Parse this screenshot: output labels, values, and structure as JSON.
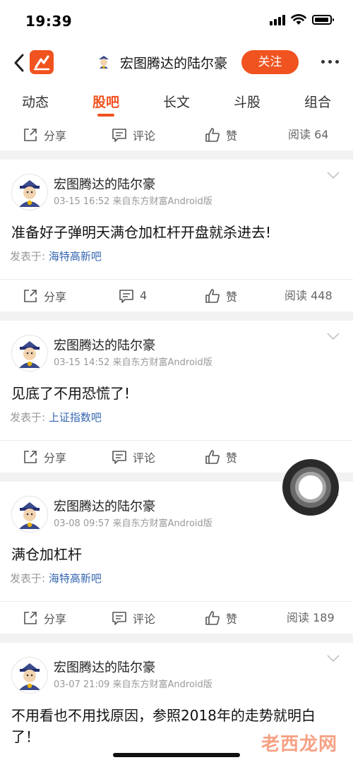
{
  "status": {
    "time": "19:39"
  },
  "header": {
    "title": "宏图腾达的陆尔豪",
    "follow_label": "关注"
  },
  "tabs": [
    {
      "label": "动态"
    },
    {
      "label": "股吧"
    },
    {
      "label": "长文"
    },
    {
      "label": "斗股"
    },
    {
      "label": "组合"
    }
  ],
  "active_tab": "股吧",
  "top_actions": {
    "share": "分享",
    "comment": "评论",
    "like": "赞",
    "read": "阅读 64"
  },
  "posts": [
    {
      "author": "宏图腾达的陆尔豪",
      "meta": "03-15 16:52 来自东方财富Android版",
      "text": "准备好子弹明天满仓加杠杆开盘就杀进去!",
      "origin_prefix": "发表于:",
      "board": "海特高新吧",
      "share": "分享",
      "comment": "4",
      "like": "赞",
      "read": "阅读 448"
    },
    {
      "author": "宏图腾达的陆尔豪",
      "meta": "03-15 14:52 来自东方财富Android版",
      "text": "见底了不用恐慌了!",
      "origin_prefix": "发表于:",
      "board": "上证指数吧",
      "share": "分享",
      "comment": "评论",
      "like": "赞",
      "read": ""
    },
    {
      "author": "宏图腾达的陆尔豪",
      "meta": "03-08 09:57 来自东方财富Android版",
      "text": "满仓加杠杆",
      "origin_prefix": "发表于:",
      "board": "海特高新吧",
      "share": "分享",
      "comment": "评论",
      "like": "赞",
      "read": "阅读 189"
    },
    {
      "author": "宏图腾达的陆尔豪",
      "meta": "03-07 21:09 来自东方财富Android版",
      "text": "不用看也不用找原因，参照2018年的走势就明白了！"
    }
  ],
  "watermark": "老西龙网",
  "colors": {
    "accent": "#f0531f",
    "board_link": "#3566b0"
  }
}
